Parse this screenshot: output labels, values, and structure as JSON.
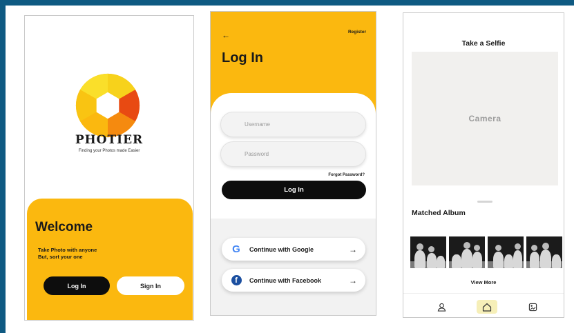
{
  "colors": {
    "frame": "#0f5a82",
    "accent": "#fbb80f",
    "dark": "#0d0d0d",
    "camera_bg": "#f1f0ee"
  },
  "splash": {
    "brand": "PHOTIER",
    "tagline": "Finding your Photos made Easier",
    "welcome": "Welcome",
    "subtitle_line1": "Take Photo with anyone",
    "subtitle_line2": "But, sort your one",
    "login_label": "Log In",
    "signin_label": "Sign In",
    "logo_icon": "aperture-logo-icon"
  },
  "login": {
    "back_icon": "back-arrow-icon",
    "back_glyph": "←",
    "register_label": "Register",
    "title": "Log In",
    "username_placeholder": "Username",
    "password_placeholder": "Password",
    "forgot_label": "Forgot Password?",
    "login_label": "Log In",
    "google_label": "Continue with Google",
    "facebook_label": "Continue with Facebook",
    "arrow_glyph": "→"
  },
  "selfie": {
    "title": "Take a Selfie",
    "camera_label": "Camera",
    "album_title": "Matched Album",
    "view_more": "View More",
    "nav": [
      {
        "icon": "user-icon"
      },
      {
        "icon": "home-icon",
        "active": true
      },
      {
        "icon": "album-icon"
      }
    ]
  }
}
